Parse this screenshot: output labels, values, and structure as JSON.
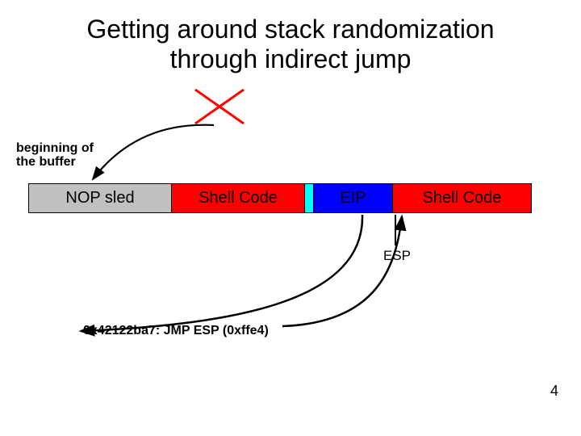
{
  "title_line1": "Getting around stack randomization",
  "title_line2": "through indirect jump",
  "beginning_label_line1": "beginning of",
  "beginning_label_line2": "the buffer",
  "segments": {
    "nop": "NOP sled",
    "shell1": "Shell Code",
    "eip": "EIP",
    "shell2": "Shell Code"
  },
  "esp_label": "ESP",
  "jmp_label": "0x42122ba7: JMP ESP (0xffe4)",
  "page_number": "4",
  "colors": {
    "nop_bg": "#c0c0c0",
    "shell_bg": "#ff0000",
    "thin_bg": "#00ffff",
    "eip_bg": "#0000ff",
    "cross": "#ff0000"
  }
}
